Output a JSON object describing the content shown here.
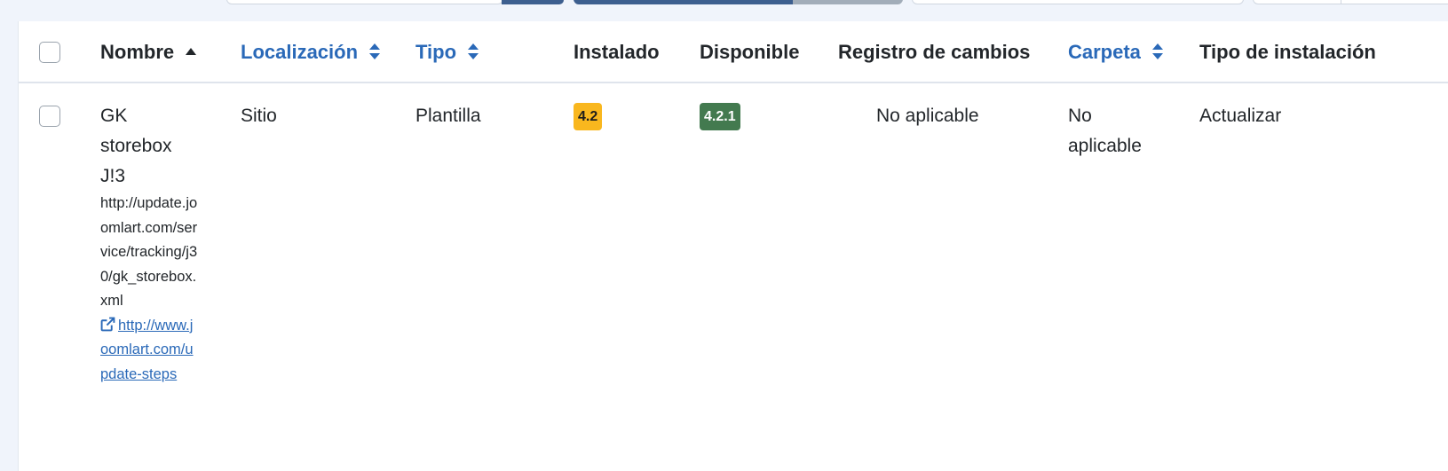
{
  "table": {
    "headers": {
      "nombre": "Nombre",
      "localizacion": "Localización",
      "tipo": "Tipo",
      "instalado": "Instalado",
      "disponible": "Disponible",
      "registro": "Registro de cambios",
      "carpeta": "Carpeta",
      "tipo_instalacion": "Tipo de instalación"
    },
    "rows": [
      {
        "name": "GK storebox J!3",
        "update_url": "http://update.joomlart.com/service/tracking/j30/gk_storebox.xml",
        "info_link": "http://www.joomlart.com/update-steps",
        "location": "Sitio",
        "type": "Plantilla",
        "installed": "4.2",
        "available": "4.2.1",
        "changelog": "No aplicable",
        "folder": "No aplicable",
        "install_type": "Actualizar"
      }
    ]
  },
  "colors": {
    "link": "#2a69b8",
    "badge_installed": "#f9b71e",
    "badge_available": "#437a4f",
    "toolbar_primary": "#3d5f8f"
  },
  "icons": {
    "sort_asc": "caret-up-icon",
    "sort_both": "sort-icon",
    "external_link": "external-link-icon"
  }
}
